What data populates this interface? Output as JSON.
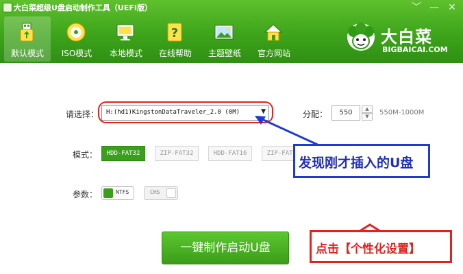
{
  "window": {
    "title": "大白菜超级U盘启动制作工具（UEFI版）",
    "controls": [
      "﹀",
      "—",
      "✕"
    ]
  },
  "nav": {
    "items": [
      {
        "label": "默认模式",
        "icon": "usb-drive-icon",
        "active": true
      },
      {
        "label": "ISO模式",
        "icon": "disc-icon",
        "active": false
      },
      {
        "label": "本地模式",
        "icon": "monitor-icon",
        "active": false
      },
      {
        "label": "在线帮助",
        "icon": "help-icon",
        "active": false
      },
      {
        "label": "主题壁纸",
        "icon": "wallpaper-icon",
        "active": false
      },
      {
        "label": "官方网站",
        "icon": "home-icon",
        "active": false
      }
    ]
  },
  "logo": {
    "text": "大白菜",
    "url": "BIGBAICAI.COM"
  },
  "form": {
    "select_label": "请选择：",
    "device_value": "H:(hd1)KingstonDataTraveler_2.0 (0M)",
    "partition_label": "分配：",
    "partition_value": "550",
    "partition_range": "550M-1000M",
    "mode_label": "模式：",
    "modes": [
      "HDD-FAT32",
      "ZIP-FAT32",
      "HDD-FAT16",
      "ZIP-FAT16"
    ],
    "active_mode": "HDD-FAT32",
    "params_label": "参数：",
    "param_ntfs": "NTFS",
    "param_chs": "CHS",
    "make_button": "一键制作启动U盘"
  },
  "annotations": {
    "callout_device": "发现刚才插入的U盘",
    "callout_custom": "点击【个性化设置】"
  },
  "colors": {
    "brand_green": "#3da41b",
    "annotation_blue": "#1f3bd4",
    "annotation_red": "#e0231c"
  }
}
